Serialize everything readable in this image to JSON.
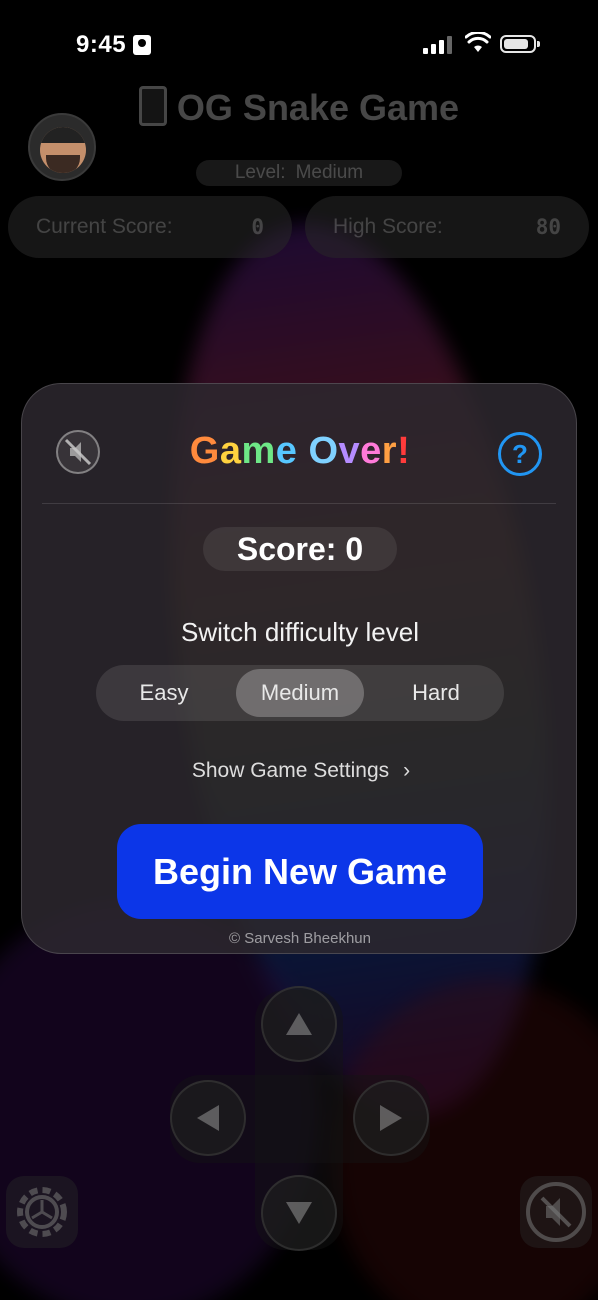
{
  "status_bar": {
    "time": "9:45"
  },
  "background": {
    "title": "OG Snake Game",
    "level_label": "Level:",
    "level_value": "Medium",
    "current_score_label": "Current Score:",
    "current_score_value": "0",
    "high_score_label": "High Score:",
    "high_score_value": "80"
  },
  "dialog": {
    "title_letters": [
      "G",
      "a",
      "m",
      "e",
      " ",
      "O",
      "v",
      "e",
      "r",
      "!"
    ],
    "title_colors": [
      "#ff8a3d",
      "#ffd23f",
      "#6ee787",
      "#57c7ff",
      "#ffffff",
      "#7fd1ff",
      "#b58cff",
      "#ff7ad9",
      "#ff9f43",
      "#ff3b3b"
    ],
    "score_text": "Score: 0",
    "switch_label": "Switch difficulty level",
    "difficulty_options": [
      "Easy",
      "Medium",
      "Hard"
    ],
    "selected_difficulty": "Medium",
    "settings_link": "Show Game Settings",
    "begin_button": "Begin New Game",
    "footer": "© Sarvesh Bheekhun"
  },
  "colors": {
    "begin_button": "#0c36e8",
    "help_icon": "#2196f3"
  },
  "icons": [
    "mute-icon",
    "help-icon",
    "chevron-right-icon",
    "arrow-up-icon",
    "arrow-left-icon",
    "arrow-right-icon",
    "arrow-down-icon",
    "settings-gear-icon",
    "sound-off-icon"
  ]
}
